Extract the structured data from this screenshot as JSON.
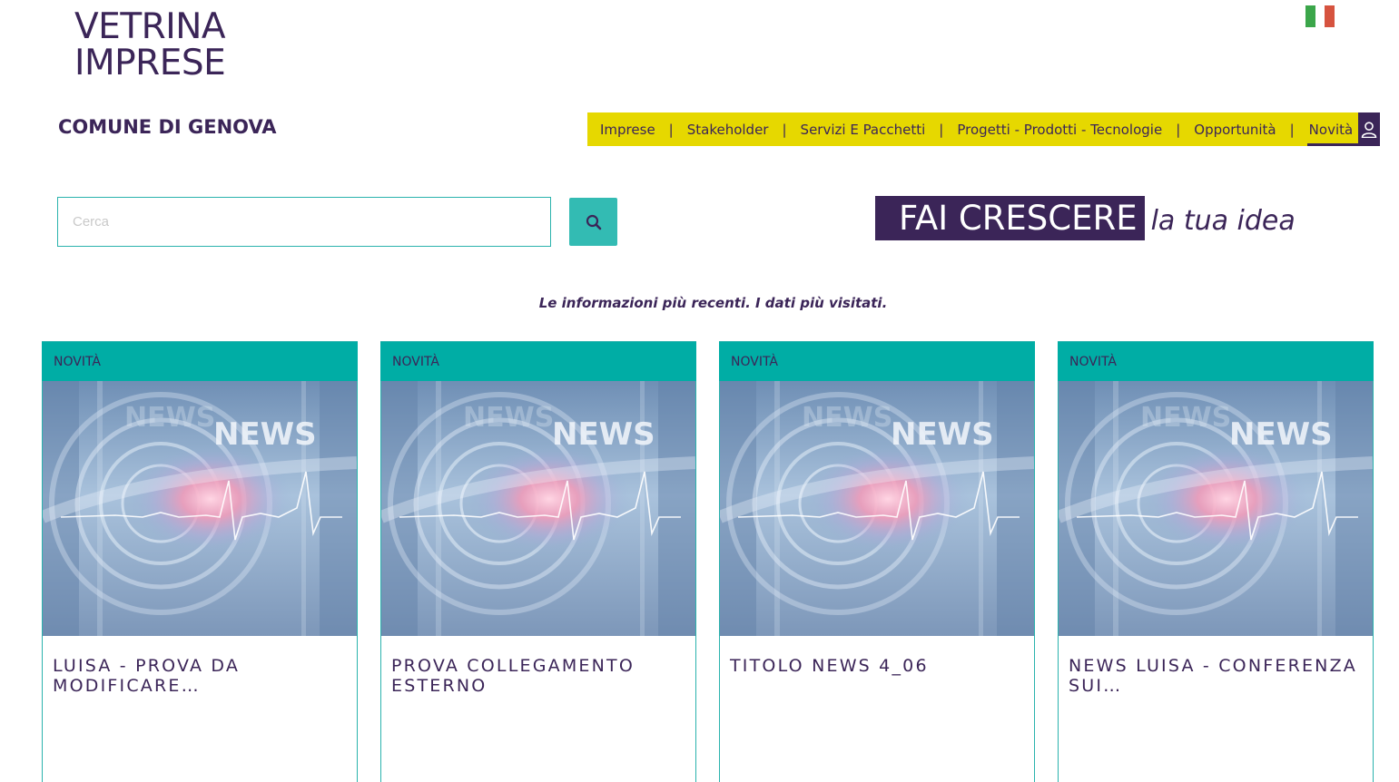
{
  "logo": {
    "line1": "VETRINA",
    "line2": "IMPRESE"
  },
  "header": {
    "municipality": "COMUNE DI GENOVA",
    "flag": "italian-flag-icon"
  },
  "nav": {
    "items": [
      {
        "label": "Imprese"
      },
      {
        "label": "Stakeholder"
      },
      {
        "label": "Servizi E Pacchetti"
      },
      {
        "label": "Progetti - Prodotti - Tecnologie"
      },
      {
        "label": "Opportunità"
      },
      {
        "label": "Novità"
      }
    ],
    "separator": "|",
    "active": "Novità",
    "user_icon": "user-icon"
  },
  "search": {
    "placeholder": "Cerca",
    "value": "",
    "button_icon": "search-icon"
  },
  "tagline": {
    "highlight": "FAI CRESCERE",
    "italic": "la tua idea"
  },
  "subtitle": "Le informazioni più recenti. I dati più visitati.",
  "cards": [
    {
      "category": "NOVITÀ",
      "image_text": "NEWS",
      "title": "LUISA - PROVA DA MODIFICARE…"
    },
    {
      "category": "NOVITÀ",
      "image_text": "NEWS",
      "title": "PROVA COLLEGAMENTO ESTERNO"
    },
    {
      "category": "NOVITÀ",
      "image_text": "NEWS",
      "title": "TITOLO NEWS 4_06"
    },
    {
      "category": "NOVITÀ",
      "image_text": "NEWS",
      "title": "NEWS LUISA - CONFERENZA SUI…"
    }
  ],
  "colors": {
    "primary": "#3b2558",
    "nav_bg": "#e6d800",
    "teal": "#00ada5",
    "search_button": "#33bbb3"
  }
}
